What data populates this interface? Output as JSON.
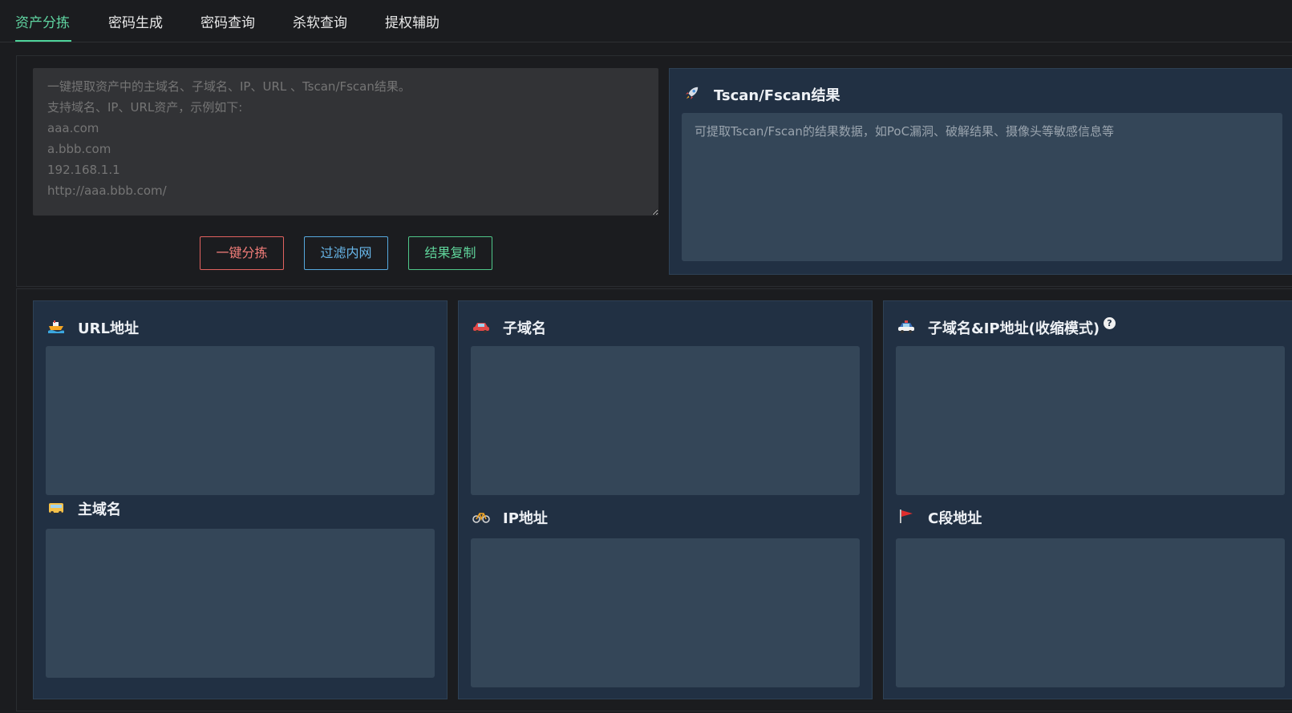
{
  "tabs": [
    {
      "label": "资产分拣",
      "active": true
    },
    {
      "label": "密码生成"
    },
    {
      "label": "密码查询"
    },
    {
      "label": "杀软查询"
    },
    {
      "label": "提权辅助"
    }
  ],
  "input": {
    "placeholder": "一键提取资产中的主域名、子域名、IP、URL 、Tscan/Fscan结果。\n支持域名、IP、URL资产，示例如下:\naaa.com\na.bbb.com\n192.168.1.1\nhttp://aaa.bbb.com/"
  },
  "buttons": {
    "sort": "一键分拣",
    "filter": "过滤内网",
    "copy": "结果复制"
  },
  "tscan": {
    "title": "Tscan/Fscan结果",
    "icon": "rocket-icon",
    "placeholder": "可提取Tscan/Fscan的结果数据，如PoC漏洞、破解结果、摄像头等敏感信息等"
  },
  "results": {
    "url": {
      "title": "URL地址",
      "icon": "ship-icon"
    },
    "main_domain": {
      "title": "主域名",
      "icon": "bus-icon"
    },
    "subdomain": {
      "title": "子域名",
      "icon": "car-icon"
    },
    "ip": {
      "title": "IP地址",
      "icon": "bicycle-icon"
    },
    "subdomain_ip": {
      "title": "子域名&IP地址(收缩模式)",
      "icon": "police-car-icon",
      "help": "?"
    },
    "c_segment": {
      "title": "C段地址",
      "icon": "flag-icon"
    }
  },
  "colors": {
    "accent": "#4ed49b",
    "red": "#e2625f",
    "blue": "#56a9de",
    "green": "#4fc789",
    "card_bg": "#213043",
    "textbox_bg": "#344658"
  }
}
